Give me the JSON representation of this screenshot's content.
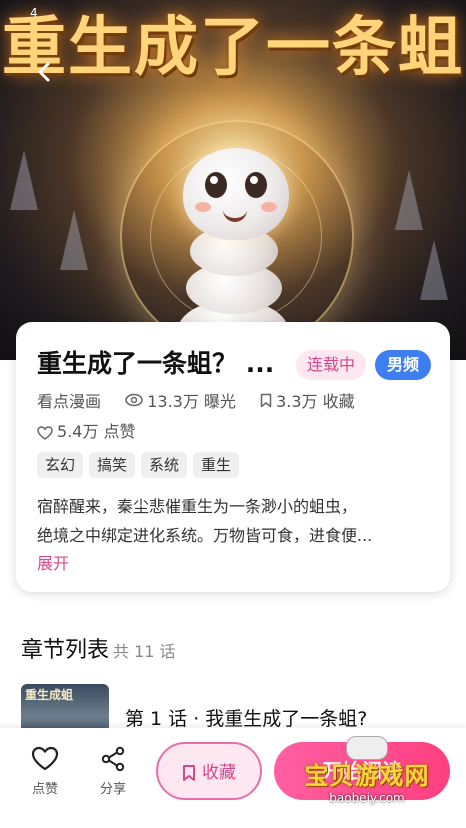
{
  "status_bar": {
    "time_fragment": "4"
  },
  "cover": {
    "title_art": "重生成了一条蛆"
  },
  "book": {
    "title": "重生成了一条蛆？ ...",
    "status_badge": "连载中",
    "category_badge": "男频",
    "source": "看点漫画",
    "views": "13.3万 曝光",
    "favorites": "3.3万 收藏",
    "likes": "5.4万 点赞",
    "tags": [
      "玄幻",
      "搞笑",
      "系统",
      "重生"
    ],
    "description_line1": "宿醉醒来，秦尘悲催重生为一条渺小的蛆虫，",
    "description_line2": "绝境之中绑定进化系统。万物皆可食，进食便...",
    "expand_label": "展开"
  },
  "chapters": {
    "heading": "章节列表",
    "count": "共 11 话",
    "items": [
      {
        "thumb_text": "重生成蛆",
        "title": "第 1 话 · 我重生成了一条蛆?"
      }
    ]
  },
  "bottom_bar": {
    "like_label": "点赞",
    "share_label": "分享",
    "favorite_label": "收藏",
    "read_label": "开始阅读"
  },
  "watermark": {
    "text": "宝贝游戏网",
    "url": "baobeiy.com"
  },
  "colors": {
    "accent_pink": "#d6488a",
    "badge_blue": "#3d7ff0",
    "read_button": "#ff4f8f"
  }
}
